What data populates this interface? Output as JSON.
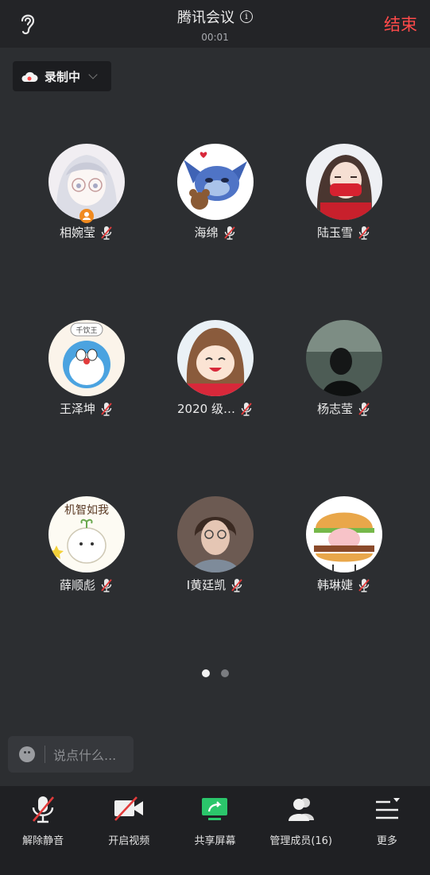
{
  "header": {
    "title": "腾讯会议",
    "timer": "00:01",
    "end_label": "结束"
  },
  "recording": {
    "label": "录制中"
  },
  "participants": [
    {
      "name": "相婉莹",
      "host": true
    },
    {
      "name": "海绵"
    },
    {
      "name": "陆玉雪"
    },
    {
      "name": "王泽坤"
    },
    {
      "name": "2020 级…"
    },
    {
      "name": "杨志莹"
    },
    {
      "name": "薛顺彪"
    },
    {
      "name": "I黄廷凯"
    },
    {
      "name": "韩琳婕"
    }
  ],
  "avatar_text": {
    "p4": "千饮王",
    "p7": "机智如我"
  },
  "pagination": {
    "pages": 2,
    "current": 1
  },
  "chat": {
    "placeholder": "说点什么..."
  },
  "toolbar": {
    "unmute": "解除静音",
    "video": "开启视频",
    "share": "共享屏幕",
    "members": "管理成员(16)",
    "more": "更多"
  },
  "colors": {
    "end": "#ff4a4a",
    "share_green": "#2bc66b",
    "host_badge": "#f08a1f",
    "mic_slash": "#e23b3b"
  }
}
